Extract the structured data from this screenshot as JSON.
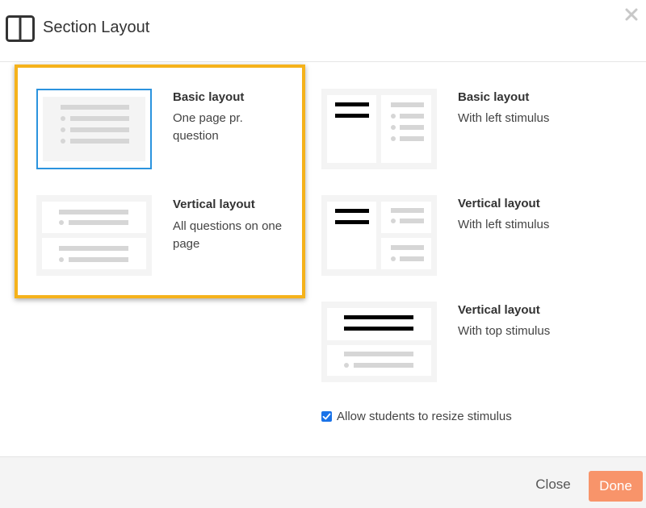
{
  "dialog": {
    "title": "Section Layout",
    "header_icon": "columns-layout-icon",
    "close_icon": "close-icon"
  },
  "layouts": [
    {
      "title": "Basic layout",
      "description": "One page pr. question",
      "selected": true
    },
    {
      "title": "Vertical layout",
      "description": "All questions on one page",
      "selected": false
    },
    {
      "title": "Basic layout",
      "description": "With left stimulus",
      "selected": false
    },
    {
      "title": "Vertical layout",
      "description": "With left stimulus",
      "selected": false
    },
    {
      "title": "Vertical layout",
      "description": "With top stimulus",
      "selected": false
    }
  ],
  "resize_option": {
    "label": "Allow students to resize stimulus",
    "checked": true
  },
  "footer": {
    "close_label": "Close",
    "done_label": "Done"
  },
  "colors": {
    "highlight": "#f5b21b",
    "selected_border": "#2b93de",
    "done_button": "#f8946a",
    "checkbox": "#1a73e8"
  }
}
